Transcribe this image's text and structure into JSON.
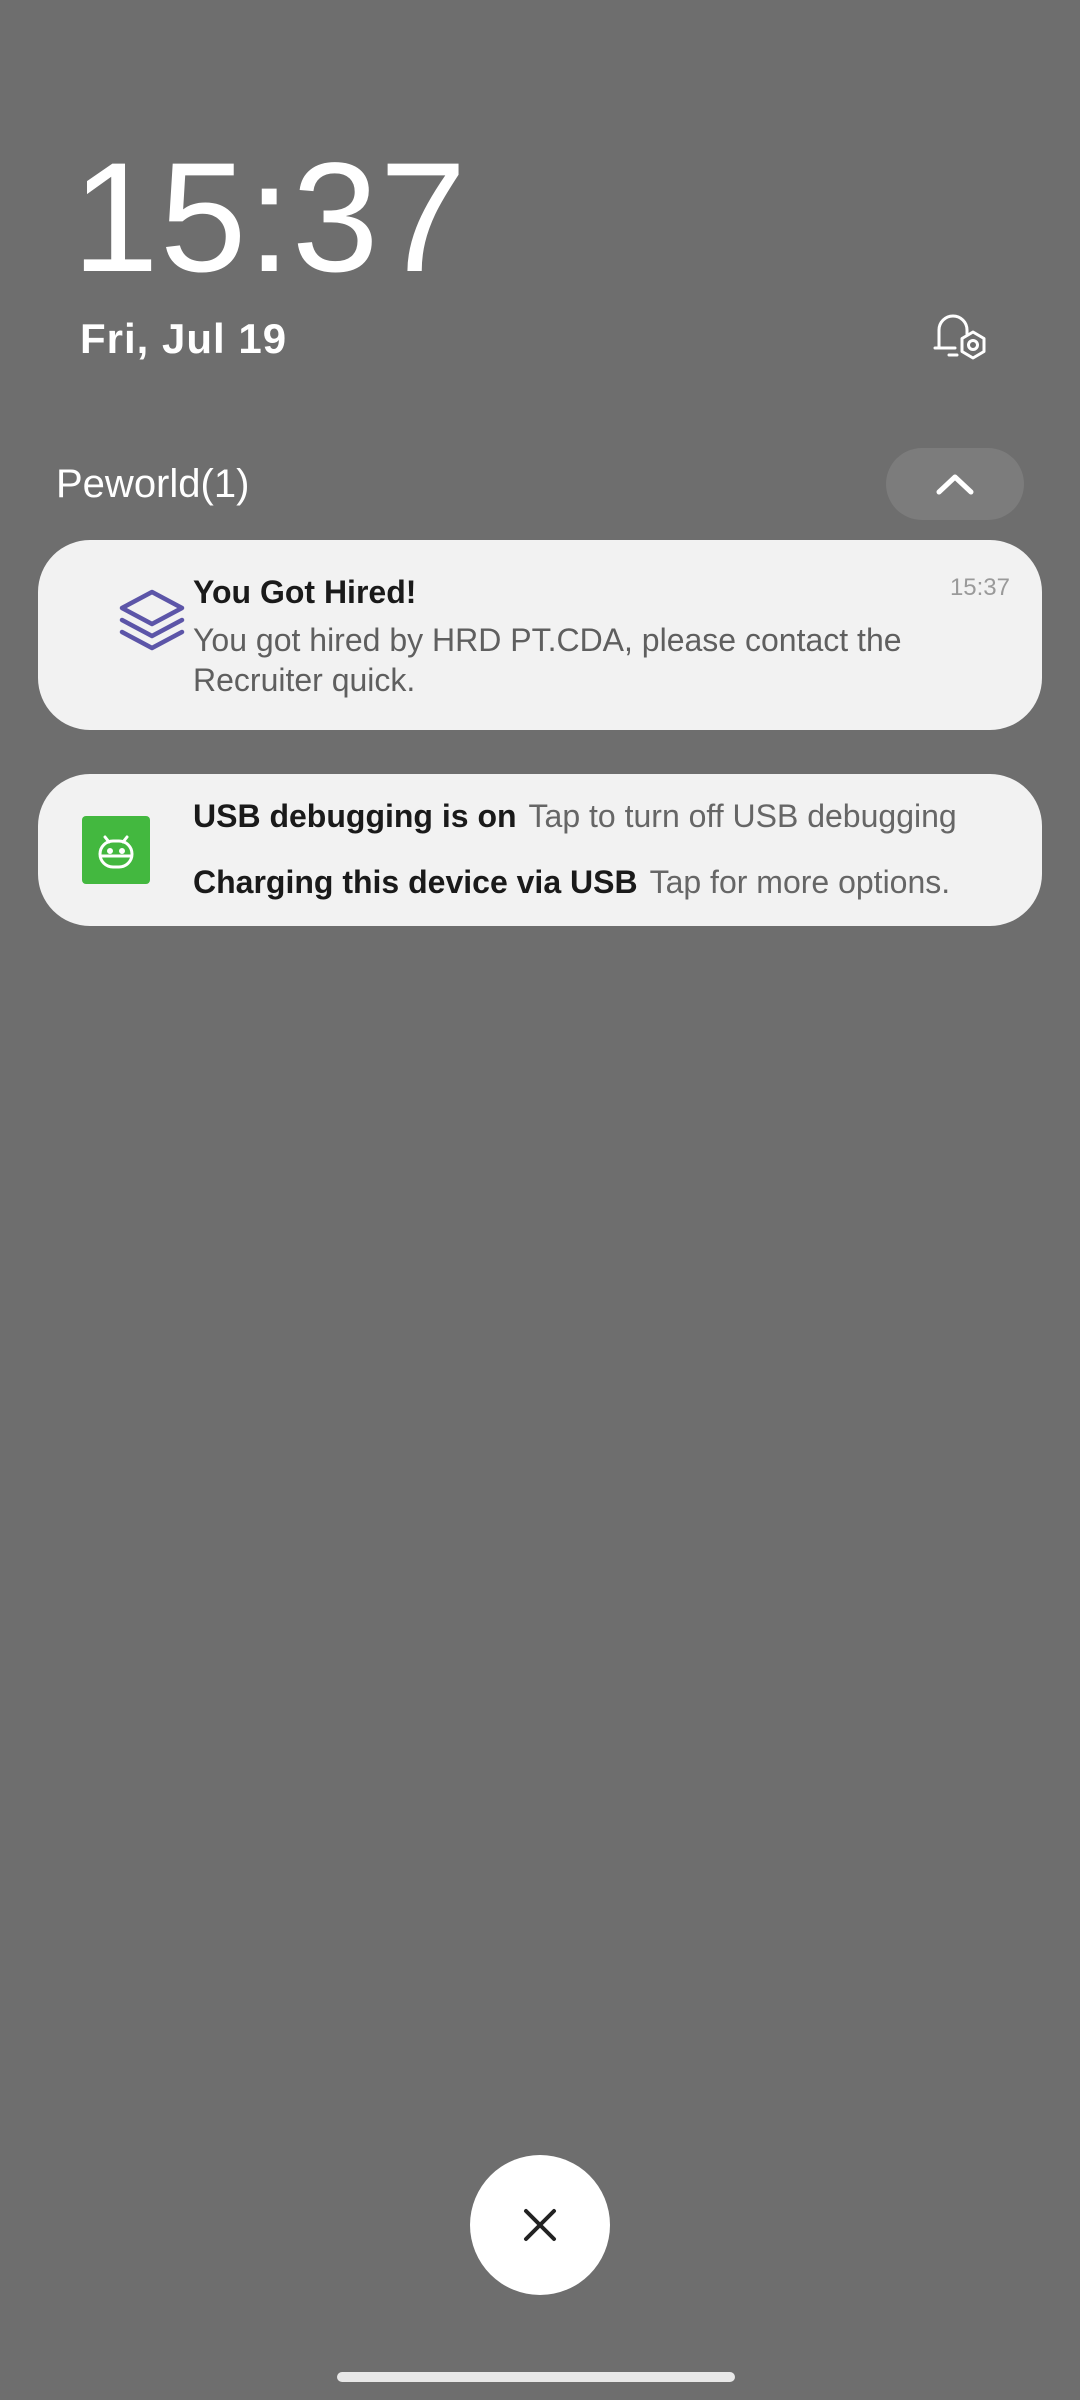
{
  "lockscreen": {
    "time": "15:37",
    "date": "Fri, Jul 19"
  },
  "notification_group": {
    "title": "Peworld(1)"
  },
  "notifications": [
    {
      "app_icon": "layers-icon",
      "title": "You Got Hired!",
      "time": "15:37",
      "body": "You got hired by HRD PT.CDA, please contact the Recruiter quick."
    },
    {
      "app_icon": "android-icon",
      "rows": [
        {
          "title": "USB debugging is on",
          "subtitle": "Tap to turn off USB debugging"
        },
        {
          "title": "Charging this device via USB",
          "subtitle": "Tap for more options."
        }
      ]
    }
  ],
  "colors": {
    "background": "#6e6e6e",
    "card": "#f2f2f2",
    "layers_icon": "#5c55a8",
    "android_green": "#43b83f"
  }
}
